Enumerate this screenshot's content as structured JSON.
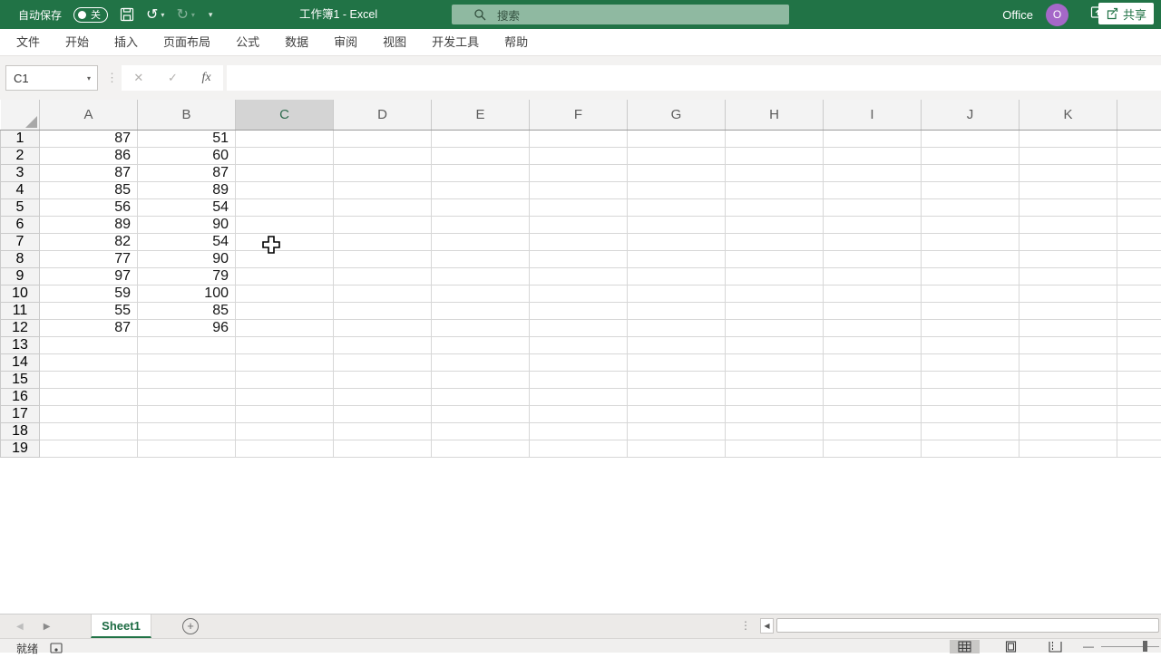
{
  "colors": {
    "green": "#217346",
    "search-bg": "#8fb9a1",
    "avatar": "#a568c8"
  },
  "titlebar": {
    "autosave_label": "自动保存",
    "autosave_state": "关",
    "title": "工作簿1 - Excel",
    "search_placeholder": "搜索",
    "office_label": "Office",
    "avatar_initial": "O",
    "minimize_glyph": "—"
  },
  "ribbon": {
    "tabs": [
      "文件",
      "开始",
      "插入",
      "页面布局",
      "公式",
      "数据",
      "审阅",
      "视图",
      "开发工具",
      "帮助"
    ],
    "share_label": "共享"
  },
  "formula_bar": {
    "name_box_value": "C1",
    "cancel_glyph": "✕",
    "enter_glyph": "✓",
    "fx_label": "fx",
    "formula_value": ""
  },
  "grid": {
    "columns": [
      "A",
      "B",
      "C",
      "D",
      "E",
      "F",
      "G",
      "H",
      "I",
      "J",
      "K"
    ],
    "selected_column": "C",
    "selected_cell": "C1",
    "row_count": 19,
    "cell_rows": [
      [
        87,
        51
      ],
      [
        86,
        60
      ],
      [
        87,
        87
      ],
      [
        85,
        89
      ],
      [
        56,
        54
      ],
      [
        89,
        90
      ],
      [
        82,
        54
      ],
      [
        77,
        90
      ],
      [
        97,
        79
      ],
      [
        59,
        100
      ],
      [
        55,
        85
      ],
      [
        87,
        96
      ]
    ]
  },
  "sheet_bar": {
    "active_tab": "Sheet1"
  },
  "status_bar": {
    "ready_label": "就绪"
  }
}
